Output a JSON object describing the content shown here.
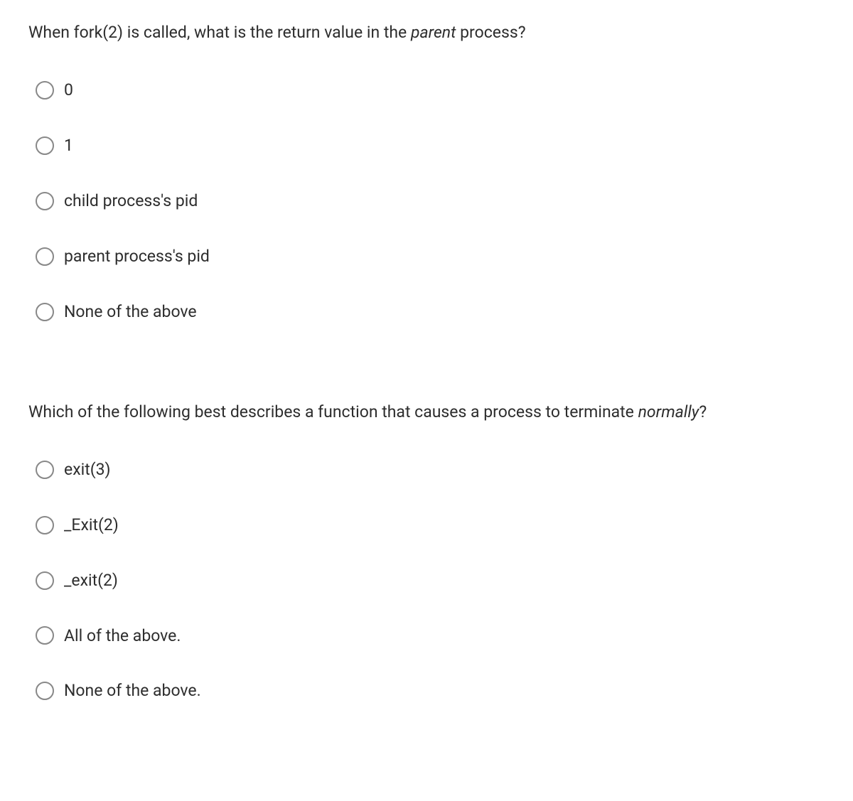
{
  "questions": [
    {
      "prompt_prefix": "When fork(2) is called, what is the return value in the ",
      "prompt_italic": "parent",
      "prompt_suffix": " process?",
      "options": [
        "0",
        "1",
        "child process's pid",
        "parent process's pid",
        "None of the above"
      ]
    },
    {
      "prompt_prefix": "Which of the following best describes a function that causes a process to terminate ",
      "prompt_italic": "normally",
      "prompt_suffix": "?",
      "options": [
        "exit(3)",
        "_Exit(2)",
        "_exit(2)",
        "All of the above.",
        "None of the above."
      ]
    }
  ]
}
